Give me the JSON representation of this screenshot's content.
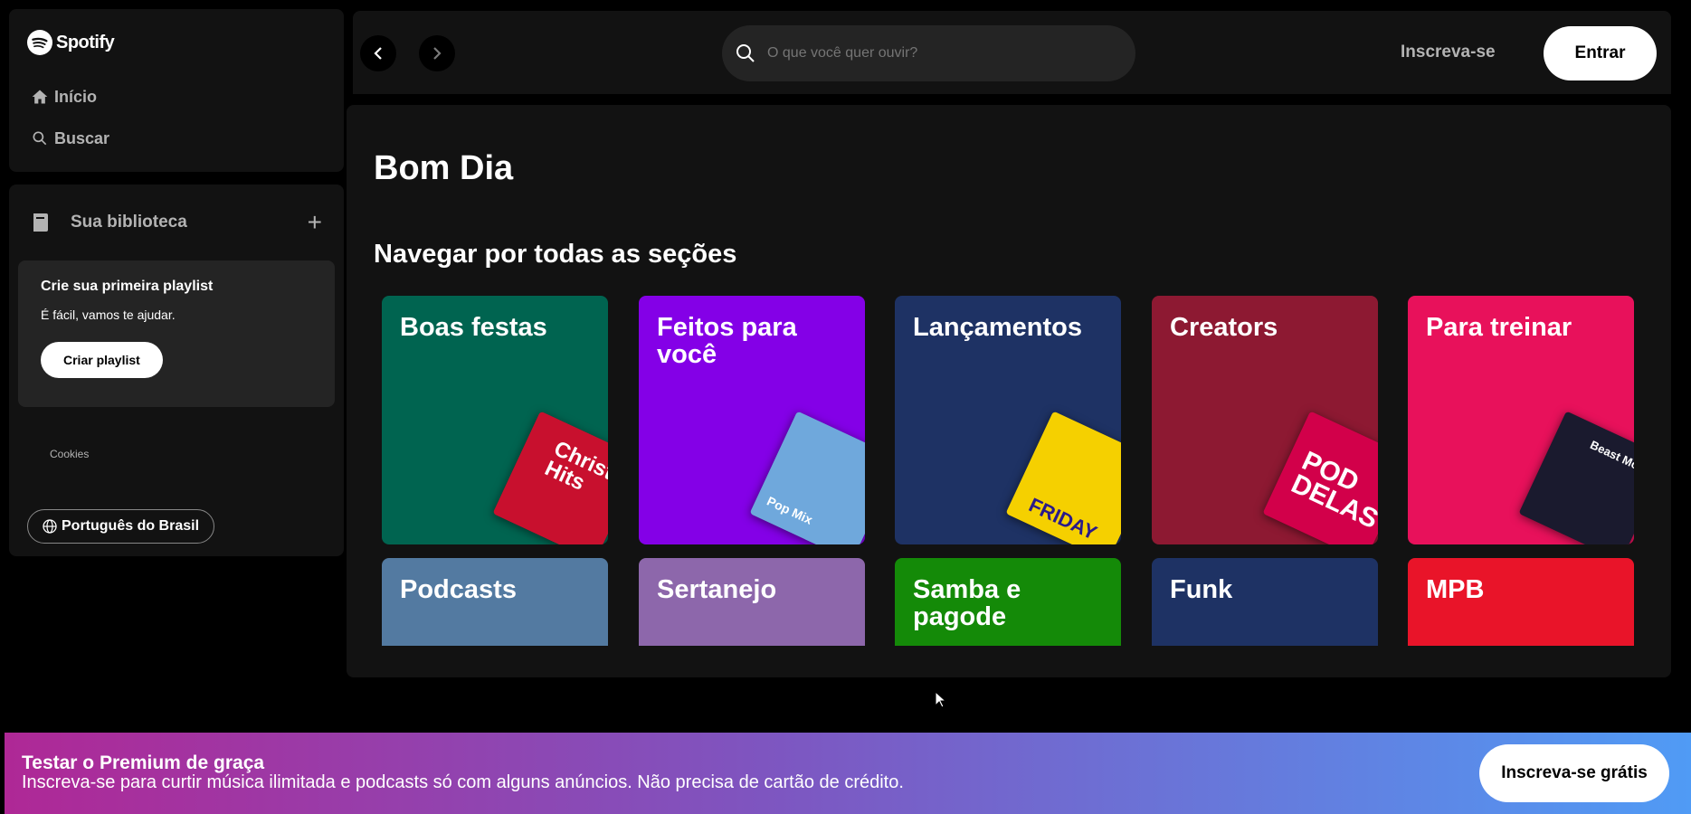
{
  "app": {
    "brand": "Spotify"
  },
  "sidebar": {
    "nav": [
      {
        "label": "Início",
        "icon": "home-icon"
      },
      {
        "label": "Buscar",
        "icon": "search-icon"
      }
    ],
    "library": {
      "title": "Sua biblioteca",
      "add_label": "+",
      "create_card": {
        "title": "Crie sua primeira playlist",
        "subtitle": "É fácil, vamos te ajudar.",
        "button": "Criar playlist"
      },
      "cookies": "Cookies",
      "language": "Português do Brasil"
    }
  },
  "topbar": {
    "search_placeholder": "O que você quer ouvir?",
    "signup": "Inscreva-se",
    "login": "Entrar"
  },
  "main": {
    "greeting": "Bom Dia",
    "section_title": "Navegar por todas as seções",
    "categories": [
      {
        "title": "Boas festas",
        "color": "#006450",
        "cover_text": "Christmas Hits",
        "cover_color": "#c8102e"
      },
      {
        "title": "Feitos para você",
        "color": "#8400e7",
        "cover_text": "Pop Mix",
        "cover_color": "#6fa8dc"
      },
      {
        "title": "Lançamentos",
        "color": "#1e3264",
        "cover_text": "FRIDAY",
        "cover_color": "#f5d000"
      },
      {
        "title": "Creators",
        "color": "#8d1932",
        "cover_text": "POD DELAS",
        "cover_color": "#d2004a"
      },
      {
        "title": "Para treinar",
        "color": "#e8115b",
        "cover_text": "Beast Mode",
        "cover_color": "#1a1a2e"
      },
      {
        "title": "Podcasts",
        "color": "#537aa1"
      },
      {
        "title": "Sertanejo",
        "color": "#8d67ab"
      },
      {
        "title": "Samba e pagode",
        "color": "#148a08"
      },
      {
        "title": "Funk",
        "color": "#1e3264"
      },
      {
        "title": "MPB",
        "color": "#e91429"
      }
    ]
  },
  "banner": {
    "title": "Testar o Premium de graça",
    "subtitle": "Inscreva-se para curtir música ilimitada e podcasts só com alguns anúncios. Não precisa de cartão de crédito.",
    "button": "Inscreva-se grátis"
  }
}
